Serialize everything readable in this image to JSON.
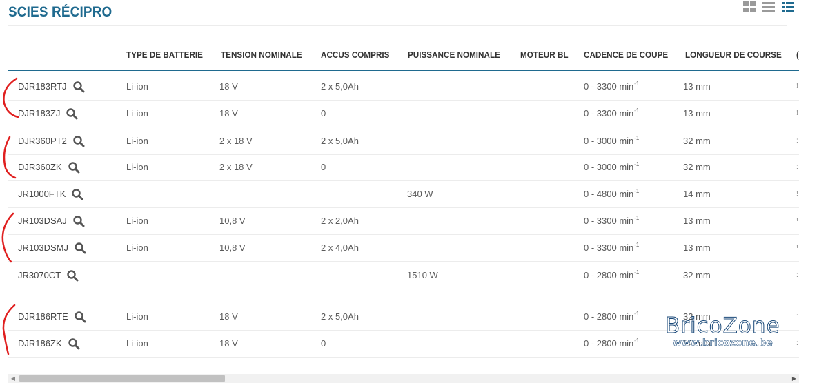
{
  "page": {
    "title": "SCIES RÉCIPRO"
  },
  "columns": [
    {
      "key": "type",
      "label": "TYPE DE BATTERIE"
    },
    {
      "key": "tension",
      "label": "TENSION NOMINALE"
    },
    {
      "key": "accus",
      "label": "ACCUS COMPRIS"
    },
    {
      "key": "puissance",
      "label": "PUISSANCE NOMINALE"
    },
    {
      "key": "moteur",
      "label": "MOTEUR BL"
    },
    {
      "key": "cadence",
      "label": "CADENCE DE COUPE"
    },
    {
      "key": "course",
      "label": "LONGUEUR DE COURSE"
    },
    {
      "key": "clipped",
      "label": "("
    }
  ],
  "rows": [
    {
      "model": "DJR183RTJ",
      "type": "Li-ion",
      "tension": "18 V",
      "accus": "2 x 5,0Ah",
      "puissance": "",
      "moteur": "",
      "cadence": "0 - 3300 min",
      "unit_exp": "-1",
      "course": "13 mm",
      "clipped": "!"
    },
    {
      "model": "DJR183ZJ",
      "type": "Li-ion",
      "tension": "18 V",
      "accus": "0",
      "puissance": "",
      "moteur": "",
      "cadence": "0 - 3300 min",
      "unit_exp": "-1",
      "course": "13 mm",
      "clipped": "!"
    },
    {
      "model": "DJR360PT2",
      "type": "Li-ion",
      "tension": "2 x 18 V",
      "accus": "2 x 5,0Ah",
      "puissance": "",
      "moteur": "",
      "cadence": "0 - 3000 min",
      "unit_exp": "-1",
      "course": "32 mm",
      "clipped": ":"
    },
    {
      "model": "DJR360ZK",
      "type": "Li-ion",
      "tension": "2 x 18 V",
      "accus": "0",
      "puissance": "",
      "moteur": "",
      "cadence": "0 - 3000 min",
      "unit_exp": "-1",
      "course": "32 mm",
      "clipped": ":"
    },
    {
      "model": "JR1000FTK",
      "type": "",
      "tension": "",
      "accus": "",
      "puissance": "340 W",
      "moteur": "",
      "cadence": "0 - 4800 min",
      "unit_exp": "-1",
      "course": "14 mm",
      "clipped": "!"
    },
    {
      "model": "JR103DSAJ",
      "type": "Li-ion",
      "tension": "10,8 V",
      "accus": "2 x 2,0Ah",
      "puissance": "",
      "moteur": "",
      "cadence": "0 - 3300 min",
      "unit_exp": "-1",
      "course": "13 mm",
      "clipped": "!"
    },
    {
      "model": "JR103DSMJ",
      "type": "Li-ion",
      "tension": "10,8 V",
      "accus": "2 x 4,0Ah",
      "puissance": "",
      "moteur": "",
      "cadence": "0 - 3300 min",
      "unit_exp": "-1",
      "course": "13 mm",
      "clipped": "!"
    },
    {
      "model": "JR3070CT",
      "type": "",
      "tension": "",
      "accus": "",
      "puissance": "1510 W",
      "moteur": "",
      "cadence": "0 - 2800 min",
      "unit_exp": "-1",
      "course": "32 mm",
      "clipped": ":"
    },
    {
      "model": "DJR186RTE",
      "type": "Li-ion",
      "tension": "18 V",
      "accus": "2 x 5,0Ah",
      "puissance": "",
      "moteur": "",
      "cadence": "0 - 2800 min",
      "unit_exp": "-1",
      "course": "32 mm",
      "clipped": ":"
    },
    {
      "model": "DJR186ZK",
      "type": "Li-ion",
      "tension": "18 V",
      "accus": "0",
      "puissance": "",
      "moteur": "",
      "cadence": "0 - 2800 min",
      "unit_exp": "-1",
      "course": "32 mm",
      "clipped": ":"
    }
  ],
  "scroll_position": 0.0,
  "watermark": {
    "title": "BricoZone",
    "url": "www.bricozone.be"
  },
  "colors": {
    "title": "#1f6a8f",
    "header_rule": "#1f6a8f",
    "view_icon_inactive": "#9a9a9a",
    "view_icon_active": "#1f6a8f",
    "annotation": "#e01f1f"
  },
  "icons": {
    "view_grid": "grid-view-icon",
    "view_list": "list-view-icon",
    "view_detail": "detail-list-view-icon",
    "row_action": "search-icon"
  }
}
